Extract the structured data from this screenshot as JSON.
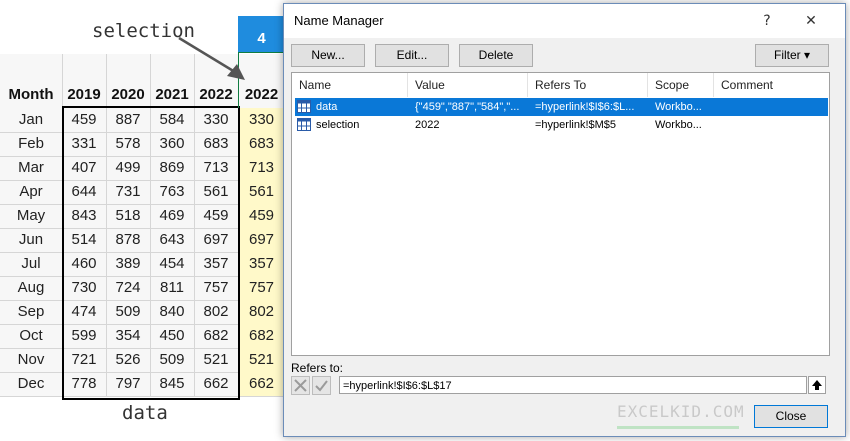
{
  "sheet": {
    "column_headers": [
      "Month",
      "2019",
      "2020",
      "2021",
      "2022",
      "2022"
    ],
    "top_cell_value": "4",
    "rows": [
      {
        "month": "Jan",
        "values": [
          "459",
          "887",
          "584",
          "330"
        ],
        "sel": "330"
      },
      {
        "month": "Feb",
        "values": [
          "331",
          "578",
          "360",
          "683"
        ],
        "sel": "683"
      },
      {
        "month": "Mar",
        "values": [
          "407",
          "499",
          "869",
          "713"
        ],
        "sel": "713"
      },
      {
        "month": "Apr",
        "values": [
          "644",
          "731",
          "763",
          "561"
        ],
        "sel": "561"
      },
      {
        "month": "May",
        "values": [
          "843",
          "518",
          "469",
          "459"
        ],
        "sel": "459"
      },
      {
        "month": "Jun",
        "values": [
          "514",
          "878",
          "643",
          "697"
        ],
        "sel": "697"
      },
      {
        "month": "Jul",
        "values": [
          "460",
          "389",
          "454",
          "357"
        ],
        "sel": "357"
      },
      {
        "month": "Aug",
        "values": [
          "730",
          "724",
          "811",
          "757"
        ],
        "sel": "757"
      },
      {
        "month": "Sep",
        "values": [
          "474",
          "509",
          "840",
          "802"
        ],
        "sel": "802"
      },
      {
        "month": "Oct",
        "values": [
          "599",
          "354",
          "450",
          "682"
        ],
        "sel": "682"
      },
      {
        "month": "Nov",
        "values": [
          "721",
          "526",
          "509",
          "521"
        ],
        "sel": "521"
      },
      {
        "month": "Dec",
        "values": [
          "778",
          "797",
          "845",
          "662"
        ],
        "sel": "662"
      }
    ],
    "annotation_selection": "selection",
    "annotation_data": "data"
  },
  "dialog": {
    "title": "Name Manager",
    "help_label": "?",
    "close_x": "✕",
    "buttons": {
      "new": "New...",
      "edit": "Edit...",
      "delete": "Delete",
      "filter": "Filter ▾"
    },
    "columns": [
      "Name",
      "Value",
      "Refers To",
      "Scope",
      "Comment"
    ],
    "names": [
      {
        "name": "data",
        "value": "{\"459\",\"887\",\"584\",\"...",
        "refers_to": "=hyperlink!$I$6:$L...",
        "scope": "Workbo...",
        "comment": ""
      },
      {
        "name": "selection",
        "value": "2022",
        "refers_to": "=hyperlink!$M$5",
        "scope": "Workbo...",
        "comment": ""
      }
    ],
    "refers_to_label": "Refers to:",
    "refers_to_value": "=hyperlink!$I$6:$L$17",
    "close_button": "Close",
    "logo_text": "EXCELKID.COM"
  },
  "colors": {
    "selected_row": "#0a78d7",
    "highlight": "#fff9c9",
    "header_blue": "#1f8cde"
  }
}
